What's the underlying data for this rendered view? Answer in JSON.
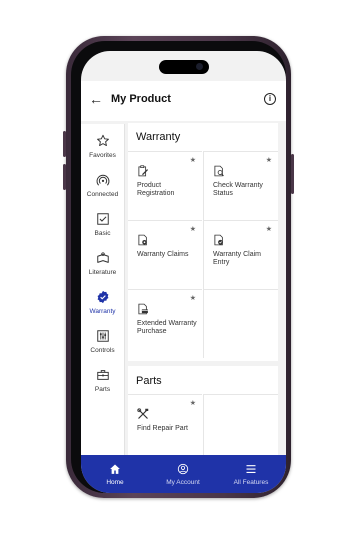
{
  "header": {
    "title": "My Product"
  },
  "sidebar": {
    "items": [
      {
        "label": "Favorites",
        "icon": "star-icon",
        "active": false
      },
      {
        "label": "Connected",
        "icon": "wireless-icon",
        "active": false
      },
      {
        "label": "Basic",
        "icon": "checkbox-icon",
        "active": false
      },
      {
        "label": "Literature",
        "icon": "book-icon",
        "active": false
      },
      {
        "label": "Warranty",
        "icon": "warranty-shield-icon",
        "active": true
      },
      {
        "label": "Controls",
        "icon": "sliders-icon",
        "active": false
      },
      {
        "label": "Parts",
        "icon": "toolbox-icon",
        "active": false
      }
    ]
  },
  "warranty": {
    "heading": "Warranty",
    "tiles": [
      {
        "label": "Product Registration",
        "icon": "clipboard-edit-icon"
      },
      {
        "label": "Check Warranty Status",
        "icon": "document-search-icon"
      },
      {
        "label": "Warranty Claims",
        "icon": "document-gear-icon"
      },
      {
        "label": "Warranty Claim Entry",
        "icon": "document-check-icon"
      },
      {
        "label": "Extended Warranty Purchase",
        "icon": "document-card-icon"
      }
    ]
  },
  "parts": {
    "heading": "Parts",
    "tiles": [
      {
        "label": "Find Repair Part",
        "icon": "tools-icon"
      }
    ]
  },
  "tabbar": {
    "items": [
      {
        "label": "Home",
        "icon": "home-icon"
      },
      {
        "label": "My Account",
        "icon": "account-icon"
      },
      {
        "label": "All Features",
        "icon": "menu-icon"
      }
    ]
  },
  "colors": {
    "accent": "#1f33a8",
    "background": "#f2f2f2"
  }
}
